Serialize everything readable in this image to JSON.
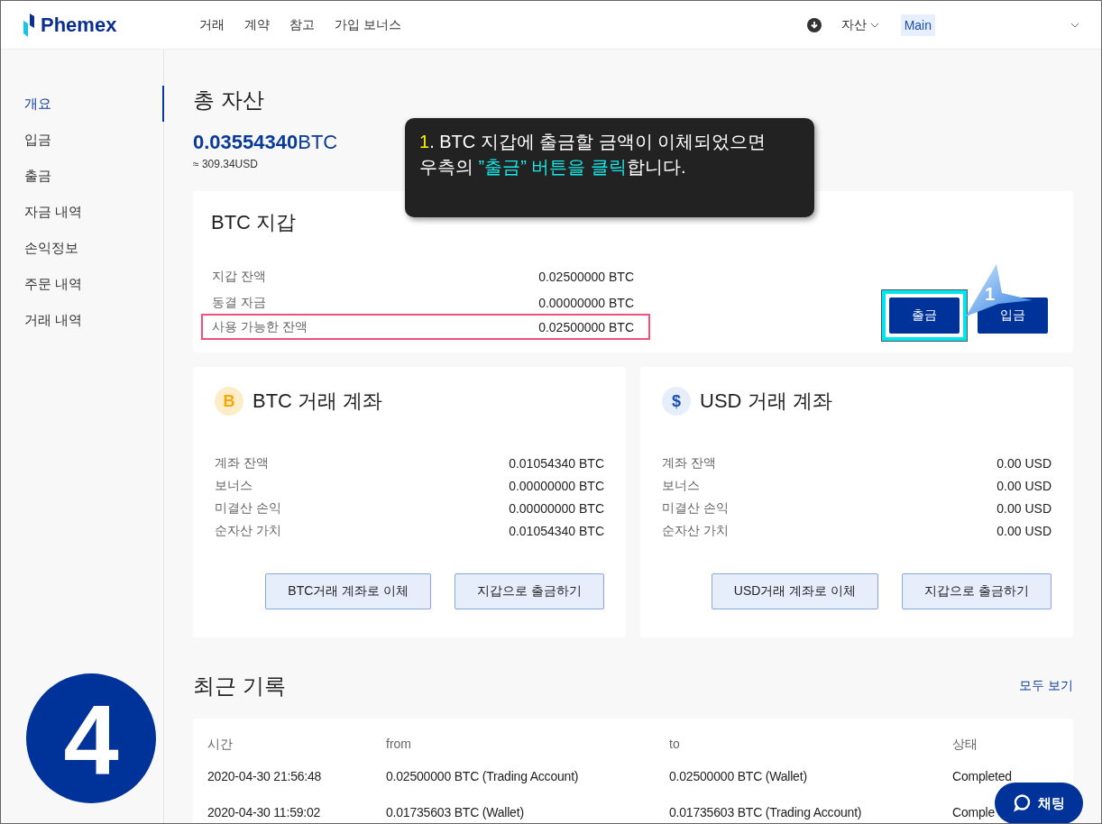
{
  "header": {
    "logo": "Phemex",
    "nav": [
      {
        "label": "거래"
      },
      {
        "label": "계약"
      },
      {
        "label": "참고"
      },
      {
        "label": "가입 보너스"
      }
    ],
    "assets_menu": "자산",
    "account": "Main"
  },
  "sidebar": {
    "items": [
      {
        "label": "개요",
        "selected": true
      },
      {
        "label": "입금",
        "selected": false
      },
      {
        "label": "출금",
        "selected": false
      },
      {
        "label": "자금 내역",
        "selected": false
      },
      {
        "label": "손익정보",
        "selected": false
      },
      {
        "label": "주문 내역",
        "selected": false
      },
      {
        "label": "거래 내역",
        "selected": false
      }
    ]
  },
  "total": {
    "title": "총 자산",
    "amount": "0.03554340",
    "unit": "BTC",
    "usd": "≈ 309.34USD"
  },
  "wallet": {
    "title": "BTC 지갑",
    "rows": [
      {
        "label": "지갑 잔액",
        "value": "0.02500000 BTC",
        "highlighted": false
      },
      {
        "label": "동결 자금",
        "value": "0.00000000 BTC",
        "highlighted": false
      },
      {
        "label": "사용 가능한 잔액",
        "value": "0.02500000 BTC",
        "highlighted": true
      }
    ],
    "buttons": [
      {
        "label": "출금",
        "highlighted": true
      },
      {
        "label": "입금",
        "highlighted": false
      }
    ]
  },
  "accounts": [
    {
      "kind": "btc",
      "symbol": "B",
      "title": "BTC 거래 계좌",
      "rows": [
        {
          "label": "계좌 잔액",
          "value": "0.01054340 BTC"
        },
        {
          "label": "보너스",
          "value": "0.00000000 BTC"
        },
        {
          "label": "미결산 손익",
          "value": "0.00000000 BTC"
        },
        {
          "label": "순자산 가치",
          "value": "0.01054340 BTC"
        }
      ],
      "buttons": [
        "BTC거래 계좌로 이체",
        "지갑으로 출금하기"
      ]
    },
    {
      "kind": "usd",
      "symbol": "$",
      "title": "USD 거래 계좌",
      "rows": [
        {
          "label": "계좌 잔액",
          "value": "0.00 USD"
        },
        {
          "label": "보너스",
          "value": "0.00 USD"
        },
        {
          "label": "미결산 손익",
          "value": "0.00 USD"
        },
        {
          "label": "순자산 가치",
          "value": "0.00 USD"
        }
      ],
      "buttons": [
        "USD거래 계좌로 이체",
        "지갑으로 출금하기"
      ]
    }
  ],
  "recent": {
    "title": "최근 기록",
    "view_all": "모두 보기",
    "columns": [
      "시간",
      "from",
      "to",
      "상태"
    ],
    "rows": [
      [
        "2020-04-30 21:56:48",
        "0.02500000 BTC (Trading Account)",
        "0.02500000 BTC (Wallet)",
        "Completed"
      ],
      [
        "2020-04-30 11:59:02",
        "0.01735603 BTC (Wallet)",
        "0.01735603 BTC (Trading Account)",
        "Comple"
      ]
    ]
  },
  "callout": {
    "lines": [
      [
        {
          "text": "1",
          "color": "#fff200"
        },
        {
          "text": ". BTC 지갑에 출금할 금액이 이체되었으면",
          "color": "#ffffff"
        }
      ],
      [
        {
          "text": "우측의 ",
          "color": "#ffffff"
        },
        {
          "text": "”출금” 버튼을 클릭",
          "color": "#19e6e6"
        },
        {
          "text": "합니다.",
          "color": "#ffffff"
        }
      ]
    ]
  },
  "pointer": "1",
  "step_badge": "4",
  "chat": "채팅"
}
